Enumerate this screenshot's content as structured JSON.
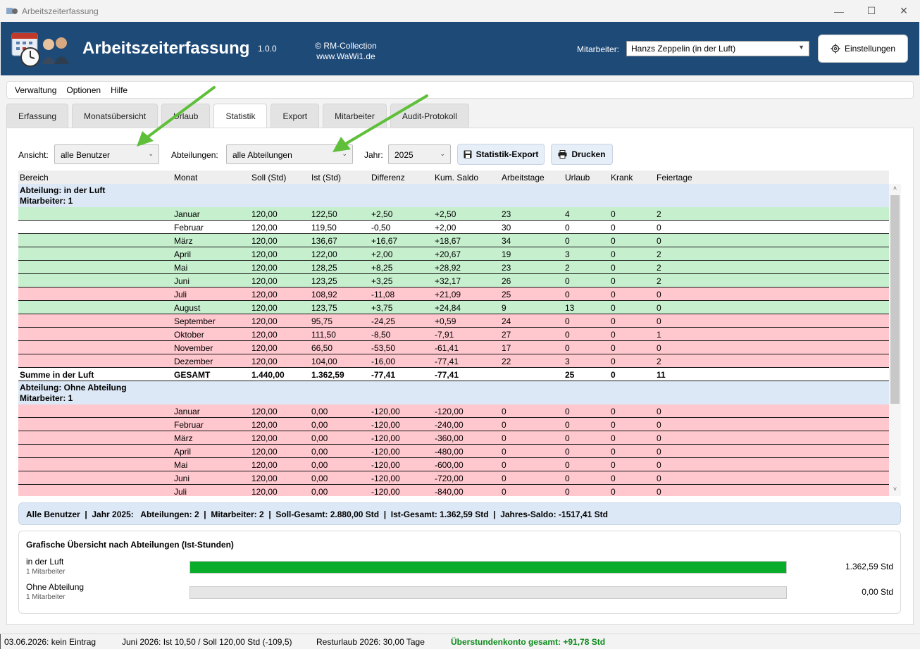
{
  "window": {
    "title": "Arbeitszeiterfassung",
    "minimize": "—",
    "maximize": "☐",
    "close": "✕"
  },
  "header": {
    "app_name": "Arbeitszeiterfassung",
    "version": "1.0.0",
    "copyright_line1": "© RM-Collection",
    "copyright_line2": "www.WaWi1.de",
    "employee_label": "Mitarbeiter:",
    "employee_value": "Hanzs Zeppelin (in der Luft)",
    "settings_label": "Einstellungen"
  },
  "menu": [
    "Verwaltung",
    "Optionen",
    "Hilfe"
  ],
  "tabs": [
    "Erfassung",
    "Monatsübersicht",
    "Urlaub",
    "Statistik",
    "Export",
    "Mitarbeiter",
    "Audit-Protokoll"
  ],
  "active_tab": "Statistik",
  "filters": {
    "view_label": "Ansicht:",
    "view_value": "alle Benutzer",
    "dept_label": "Abteilungen:",
    "dept_value": "alle Abteilungen",
    "year_label": "Jahr:",
    "year_value": "2025",
    "export_label": "Statistik-Export",
    "print_label": "Drucken"
  },
  "table": {
    "columns": [
      "Bereich",
      "Monat",
      "Soll (Std)",
      "Ist (Std)",
      "Differenz",
      "Kum. Saldo",
      "Arbeitstage",
      "Urlaub",
      "Krank",
      "Feiertage"
    ],
    "groups": [
      {
        "dept": "Abteilung: in der Luft",
        "count": "Mitarbeiter: 1",
        "rows": [
          {
            "status": "green",
            "monat": "Januar",
            "soll": "120,00",
            "ist": "122,50",
            "diff": "+2,50",
            "kum": "+2,50",
            "at": "23",
            "url": "4",
            "kr": "0",
            "ft": "2"
          },
          {
            "status": "white",
            "monat": "Februar",
            "soll": "120,00",
            "ist": "119,50",
            "diff": "-0,50",
            "kum": "+2,00",
            "at": "30",
            "url": "0",
            "kr": "0",
            "ft": "0"
          },
          {
            "status": "green",
            "monat": "März",
            "soll": "120,00",
            "ist": "136,67",
            "diff": "+16,67",
            "kum": "+18,67",
            "at": "34",
            "url": "0",
            "kr": "0",
            "ft": "0"
          },
          {
            "status": "green",
            "monat": "April",
            "soll": "120,00",
            "ist": "122,00",
            "diff": "+2,00",
            "kum": "+20,67",
            "at": "19",
            "url": "3",
            "kr": "0",
            "ft": "2"
          },
          {
            "status": "green",
            "monat": "Mai",
            "soll": "120,00",
            "ist": "128,25",
            "diff": "+8,25",
            "kum": "+28,92",
            "at": "23",
            "url": "2",
            "kr": "0",
            "ft": "2"
          },
          {
            "status": "green",
            "monat": "Juni",
            "soll": "120,00",
            "ist": "123,25",
            "diff": "+3,25",
            "kum": "+32,17",
            "at": "26",
            "url": "0",
            "kr": "0",
            "ft": "2"
          },
          {
            "status": "red",
            "monat": "Juli",
            "soll": "120,00",
            "ist": "108,92",
            "diff": "-11,08",
            "kum": "+21,09",
            "at": "25",
            "url": "0",
            "kr": "0",
            "ft": "0"
          },
          {
            "status": "green",
            "monat": "August",
            "soll": "120,00",
            "ist": "123,75",
            "diff": "+3,75",
            "kum": "+24,84",
            "at": "9",
            "url": "13",
            "kr": "0",
            "ft": "0"
          },
          {
            "status": "red",
            "monat": "September",
            "soll": "120,00",
            "ist": "95,75",
            "diff": "-24,25",
            "kum": "+0,59",
            "at": "24",
            "url": "0",
            "kr": "0",
            "ft": "0"
          },
          {
            "status": "red",
            "monat": "Oktober",
            "soll": "120,00",
            "ist": "111,50",
            "diff": "-8,50",
            "kum": "-7,91",
            "at": "27",
            "url": "0",
            "kr": "0",
            "ft": "1"
          },
          {
            "status": "red",
            "monat": "November",
            "soll": "120,00",
            "ist": "66,50",
            "diff": "-53,50",
            "kum": "-61,41",
            "at": "17",
            "url": "0",
            "kr": "0",
            "ft": "0"
          },
          {
            "status": "red",
            "monat": "Dezember",
            "soll": "120,00",
            "ist": "104,00",
            "diff": "-16,00",
            "kum": "-77,41",
            "at": "22",
            "url": "3",
            "kr": "0",
            "ft": "2"
          }
        ],
        "sum": {
          "bereich": "Summe in der Luft",
          "monat": "GESAMT",
          "soll": "1.440,00",
          "ist": "1.362,59",
          "diff": "-77,41",
          "kum": "-77,41",
          "at": "",
          "url": "25",
          "kr": "0",
          "ft": "11"
        }
      },
      {
        "dept": "Abteilung: Ohne Abteilung",
        "count": "Mitarbeiter: 1",
        "rows": [
          {
            "status": "red",
            "monat": "Januar",
            "soll": "120,00",
            "ist": "0,00",
            "diff": "-120,00",
            "kum": "-120,00",
            "at": "0",
            "url": "0",
            "kr": "0",
            "ft": "0"
          },
          {
            "status": "red",
            "monat": "Februar",
            "soll": "120,00",
            "ist": "0,00",
            "diff": "-120,00",
            "kum": "-240,00",
            "at": "0",
            "url": "0",
            "kr": "0",
            "ft": "0"
          },
          {
            "status": "red",
            "monat": "März",
            "soll": "120,00",
            "ist": "0,00",
            "diff": "-120,00",
            "kum": "-360,00",
            "at": "0",
            "url": "0",
            "kr": "0",
            "ft": "0"
          },
          {
            "status": "red",
            "monat": "April",
            "soll": "120,00",
            "ist": "0,00",
            "diff": "-120,00",
            "kum": "-480,00",
            "at": "0",
            "url": "0",
            "kr": "0",
            "ft": "0"
          },
          {
            "status": "red",
            "monat": "Mai",
            "soll": "120,00",
            "ist": "0,00",
            "diff": "-120,00",
            "kum": "-600,00",
            "at": "0",
            "url": "0",
            "kr": "0",
            "ft": "0"
          },
          {
            "status": "red",
            "monat": "Juni",
            "soll": "120,00",
            "ist": "0,00",
            "diff": "-120,00",
            "kum": "-720,00",
            "at": "0",
            "url": "0",
            "kr": "0",
            "ft": "0"
          },
          {
            "status": "red",
            "monat": "Juli",
            "soll": "120,00",
            "ist": "0,00",
            "diff": "-120,00",
            "kum": "-840,00",
            "at": "0",
            "url": "0",
            "kr": "0",
            "ft": "0"
          }
        ]
      }
    ]
  },
  "summary": "Alle Benutzer  |  Jahr 2025:   Abteilungen: 2  |  Mitarbeiter: 2  |  Soll-Gesamt: 2.880,00 Std  |  Ist-Gesamt: 1.362,59 Std  |  Jahres-Saldo: -1517,41 Std",
  "chart": {
    "title": "Grafische Übersicht nach Abteilungen (Ist-Stunden)",
    "bars": [
      {
        "label": "in der Luft",
        "sub": "1 Mitarbeiter",
        "value_text": "1.362,59 Std",
        "fraction": 1.0
      },
      {
        "label": "Ohne Abteilung",
        "sub": "1 Mitarbeiter",
        "value_text": "0,00 Std",
        "fraction": 0.0
      }
    ],
    "bar_color": "#0aad2a"
  },
  "status": {
    "s1": "03.06.2026: kein Eintrag",
    "s2": "Juni 2026: Ist 10,50 / Soll 120,00 Std (-109,5)",
    "s3": "Resturlaub 2026: 30,00 Tage",
    "s4": "Überstundenkonto gesamt: +91,78 Std",
    "s4_color": "#0a8a1a"
  },
  "colors": {
    "header_bg": "#1e4a78",
    "row_green": "#c6efce",
    "row_red": "#ffc7ce",
    "dept_bg": "#dce8f5"
  }
}
